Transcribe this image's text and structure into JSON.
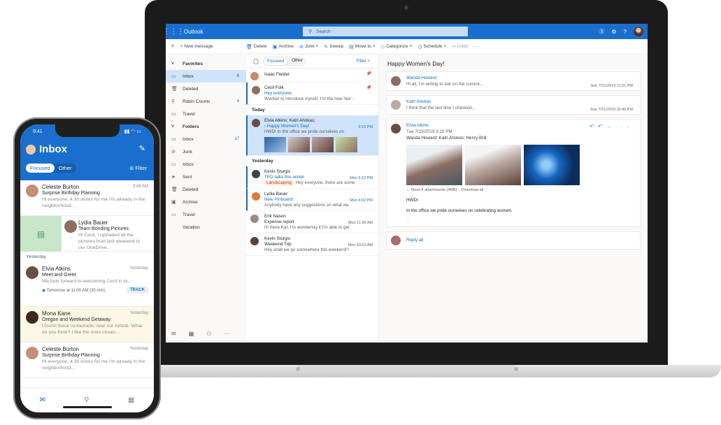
{
  "laptop": {
    "brand": "Outlook",
    "search_placeholder": "Search",
    "new_message": "New message",
    "commands": [
      "Delete",
      "Archive",
      "Junk",
      "Sweep",
      "Move to",
      "Categorize",
      "Schedule",
      "Undo"
    ],
    "folders": [
      {
        "label": "Favorites",
        "head": true
      },
      {
        "label": "Inbox",
        "count": "6",
        "selected": true
      },
      {
        "label": "Deleted"
      },
      {
        "label": "Robin Counts",
        "count": "4"
      },
      {
        "label": "Travel"
      },
      {
        "label": "Folders",
        "head": true
      },
      {
        "label": "Inbox",
        "count": "17"
      },
      {
        "label": "Junk"
      },
      {
        "label": "Inbox"
      },
      {
        "label": "Sent"
      },
      {
        "label": "Deleted"
      },
      {
        "label": "Archive"
      },
      {
        "label": "Travel"
      },
      {
        "label": "Vacation"
      }
    ],
    "list": {
      "focused": "Focused",
      "other": "Other",
      "filter": "Filter",
      "today": "Today",
      "yesterday": "Yesterday",
      "messages": [
        {
          "from": "Isaac Fielder",
          "subject": "",
          "preview": "",
          "time": ""
        },
        {
          "from": "Cecil Folk",
          "subject": "Hey everyone",
          "preview": "Wanted to introduce myself, I'm the new hire -",
          "time": ""
        },
        {
          "from": "Elvia Atkins; Katri Ahokas;",
          "subject": "Happy Women's Day!",
          "preview": "HWD! In the office we pride ourselves on",
          "time": "3:15 PM"
        },
        {
          "from": "Kevin Sturgis",
          "subject": "TED talks this winter",
          "tag": "Landscaping",
          "preview": "Hey everyone, there are some",
          "time": "Mon 6:12 PM"
        },
        {
          "from": "Lydia Bauer",
          "subject": "New Pinboard!",
          "preview": "Anybody have any suggestions on what we",
          "time": "Mon 4:02 PM"
        },
        {
          "from": "Erik Nason",
          "subject": "Expense report",
          "preview": "Hi there Kat, I'm wondering if I'm able to get",
          "time": "Mon 11:36 AM"
        },
        {
          "from": "Kevin Sturgis",
          "subject": "Weekend Trip",
          "preview": "Hey shall we go somewhere this weekend?",
          "time": "Mon 10:03 AM"
        }
      ]
    },
    "reading": {
      "title": "Happy Women's Day!",
      "cards": [
        {
          "name": "Wanda Howard",
          "line": "Hi all, I'm writing to ask on the current...",
          "date": "Sun 7/21/2019 11:51 PM"
        },
        {
          "name": "Katri Ahokas",
          "line": "I think that the last time I checked...",
          "date": "Sun 7/21/2019 10:45 PM"
        }
      ],
      "main": {
        "name": "Elvia Atkins",
        "date": "Tue 7/23/2019 3:15 PM",
        "recipients": "Wanda Howard; Katri Ahokas; Henry Brill",
        "show_attachments": "Show 4 attachments (4MB)",
        "download_all": "Download all",
        "hwd": "HWD!",
        "body": "In the office we pride ourselves on celebrating women.",
        "ellipsis": "..."
      },
      "reply_all": "Reply all"
    }
  },
  "phone": {
    "time": "9:41",
    "title": "Inbox",
    "focused": "Focused",
    "other": "Other",
    "filter": "Filter",
    "yesterday": "Yesterday",
    "messages": [
      {
        "from": "Celeste Burton",
        "subject": "Surprise Birthday Planning",
        "preview": "Hi everyone, 4:30 works for me I'm already in the neighborhood...",
        "time": "9:45 AM"
      },
      {
        "from": "Lydia Bauer",
        "subject": "Team Bonding Pictures",
        "preview": "Hi Cecil, I uploaded all the pictures from last weekend to our OneDrive...",
        "time": ""
      },
      {
        "from": "Elvia Atkins",
        "subject": "Meet and Greet",
        "preview": "We look forward to welcoming Cecil in to...",
        "time": "Yesterday",
        "track_text": "Tomorrow at 11:00 AM (30 min)",
        "track_btn": "TRACK"
      },
      {
        "from": "Mona Kane",
        "subject": "Oregon and Weekend Getaway",
        "preview": "I found these restaurants near our Airbnb. What do you think? I like the ones closes...",
        "time": "Yesterday"
      },
      {
        "from": "Celeste Burton",
        "subject": "Surprise Birthday Planning",
        "preview": "Hi everyone, 4:30 works for me I'm already in the neighborhood...",
        "time": "Yesterday"
      }
    ]
  }
}
